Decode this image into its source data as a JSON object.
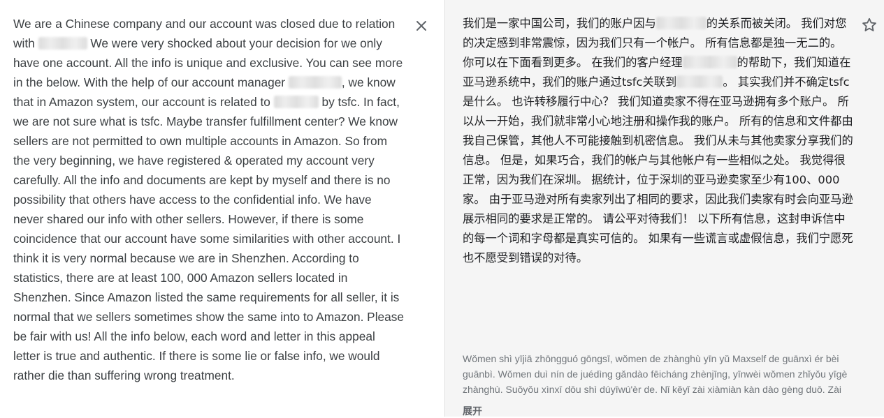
{
  "source": {
    "p1": "We are a Chinese company and our account was closed due to relation with",
    "p2": " We were very shocked about your decision for we only have one account. All the info is unique and exclusive. You can see more in the below.   With the help of our account manager ",
    "p3": ", we know that in Amazon system, our account is related to ",
    "p4": " by tsfc. In fact, we are not sure what is tsfc. Maybe transfer fulfillment center? We know sellers are not permitted to own multiple accounts in Amazon. So from the very beginning, we have registered & operated my account very carefully. All the info and documents are kept by myself and there is no possibility that others have access to the confidential info.   We have never shared our info with other sellers. However, if there is some coincidence that our account have some similarities with other account. I think it is very normal because we are in Shenzhen. According to statistics, there are at least 100, 000 Amazon sellers located in Shenzhen. Since Amazon listed the same requirements for all seller, it is normal that we sellers sometimes show the same into to Amazon.    Please be fair with us! All the info below, each word and letter in this appeal letter is true and authentic. If there is some lie or false info, we would rather die than suffering wrong treatment."
  },
  "translation": {
    "p1": "我们是一家中国公司，我们的账户因与",
    "p2": "的关系而被关闭。 我们对您的决定感到非常震惊，因为我们只有一个帐户。 所有信息都是独一无二的。 你可以在下面看到更多。 在我们的客户经理",
    "p3": "的帮助下，我们知道在亚马逊系统中，我们的账户通过tsfc关联到",
    "p4": "。 其实我们并不确定tsfc是什么。 也许转移履行中心？ 我们知道卖家不得在亚马逊拥有多个账户。 所以从一开始，我们就非常小心地注册和操作我的账户。 所有的信息和文件都由我自己保管，其他人不可能接触到机密信息。 我们从未与其他卖家分享我们的信息。 但是，如果巧合，我们的帐户与其他帐户有一些相似之处。 我觉得很正常，因为我们在深圳。 据统计，位于深圳的亚马逊卖家至少有100、000家。 由于亚马逊对所有卖家列出了相同的要求，因此我们卖家有时会向亚马逊展示相同的要求是正常的。 请公平对待我们！ 以下所有信息，这封申诉信中的每一个词和字母都是真实可信的。 如果有一些谎言或虚假信息，我们宁愿死也不愿受到错误的对待。"
  },
  "pinyin": "Wǒmen shì yījiā zhōngguó gōngsī, wǒmen de zhànghù yīn yǔ Maxself de guānxì ér bèi guānbì. Wǒmen duì nín de juédìng gǎndào fēicháng zhènjīng, yīnwèi wǒmen zhǐyǒu yīgè zhànghù. Suǒyǒu xìnxī dōu shì dúyīwú'èr de. Nǐ kěyǐ zài xiàmiàn kàn dào gèng duō. Zài",
  "expand_label": "展开",
  "icons": {
    "close": "close-icon",
    "star": "star-outline-icon"
  },
  "colors": {
    "left_bg": "#ffffff",
    "right_bg": "#f5f5f5",
    "text": "#3c4043",
    "muted": "#70757a"
  }
}
